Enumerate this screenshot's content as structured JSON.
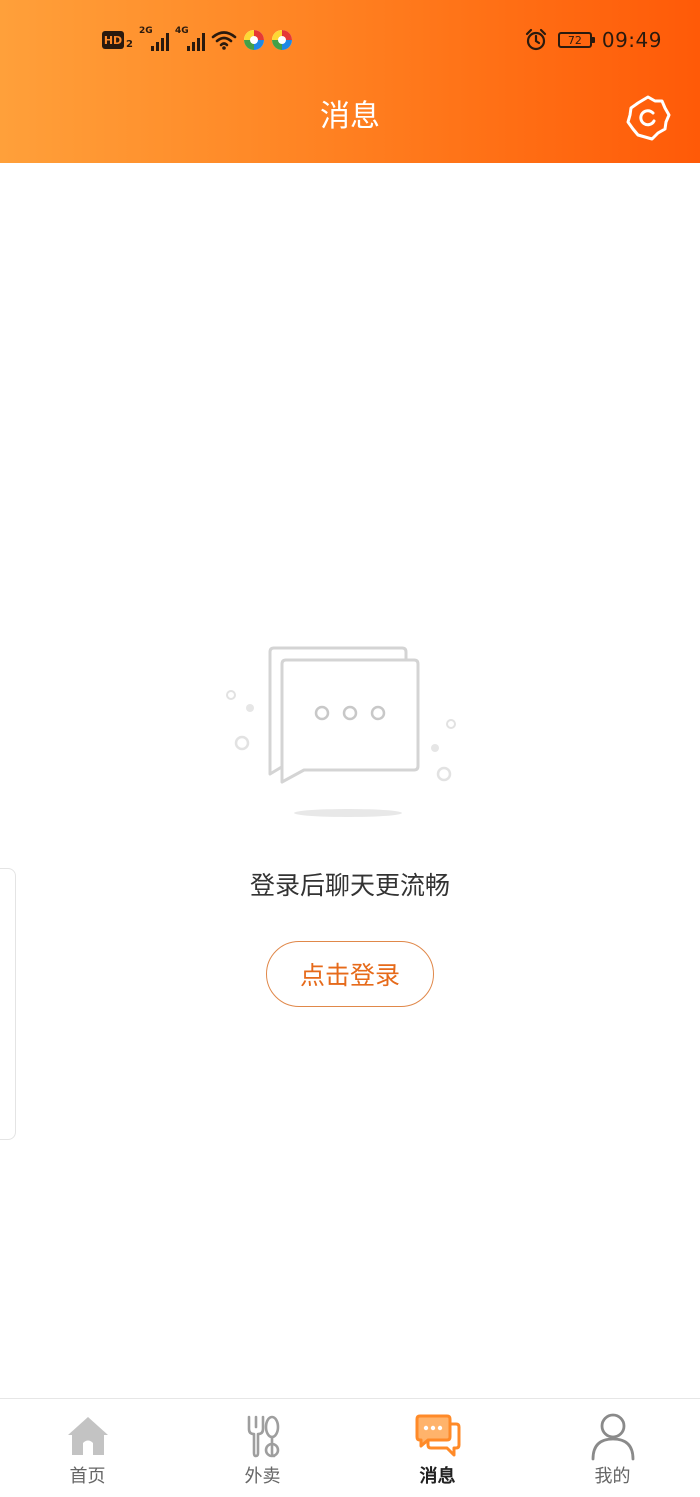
{
  "status_bar": {
    "hd_label": "HD",
    "hd_sub": "2",
    "sim1_label": "2G",
    "sim2_label": "4G",
    "battery_level": "72",
    "time": "09:49"
  },
  "header": {
    "title": "消息",
    "settings_icon": "gear-icon"
  },
  "empty_state": {
    "illustration_icon": "chat-bubbles-icon",
    "message": "登录后聊天更流畅",
    "login_button_label": "点击登录"
  },
  "bottom_nav": {
    "items": [
      {
        "label": "首页",
        "icon": "home-icon",
        "active": false
      },
      {
        "label": "外卖",
        "icon": "fork-spoon-icon",
        "active": false
      },
      {
        "label": "消息",
        "icon": "message-icon",
        "active": true
      },
      {
        "label": "我的",
        "icon": "profile-icon",
        "active": false
      }
    ]
  },
  "colors": {
    "header_start": "#ffa03a",
    "header_end": "#ff5a08",
    "accent": "#e66a1a",
    "nav_active": "#ff8a28",
    "nav_inactive": "#bdbdbd"
  }
}
